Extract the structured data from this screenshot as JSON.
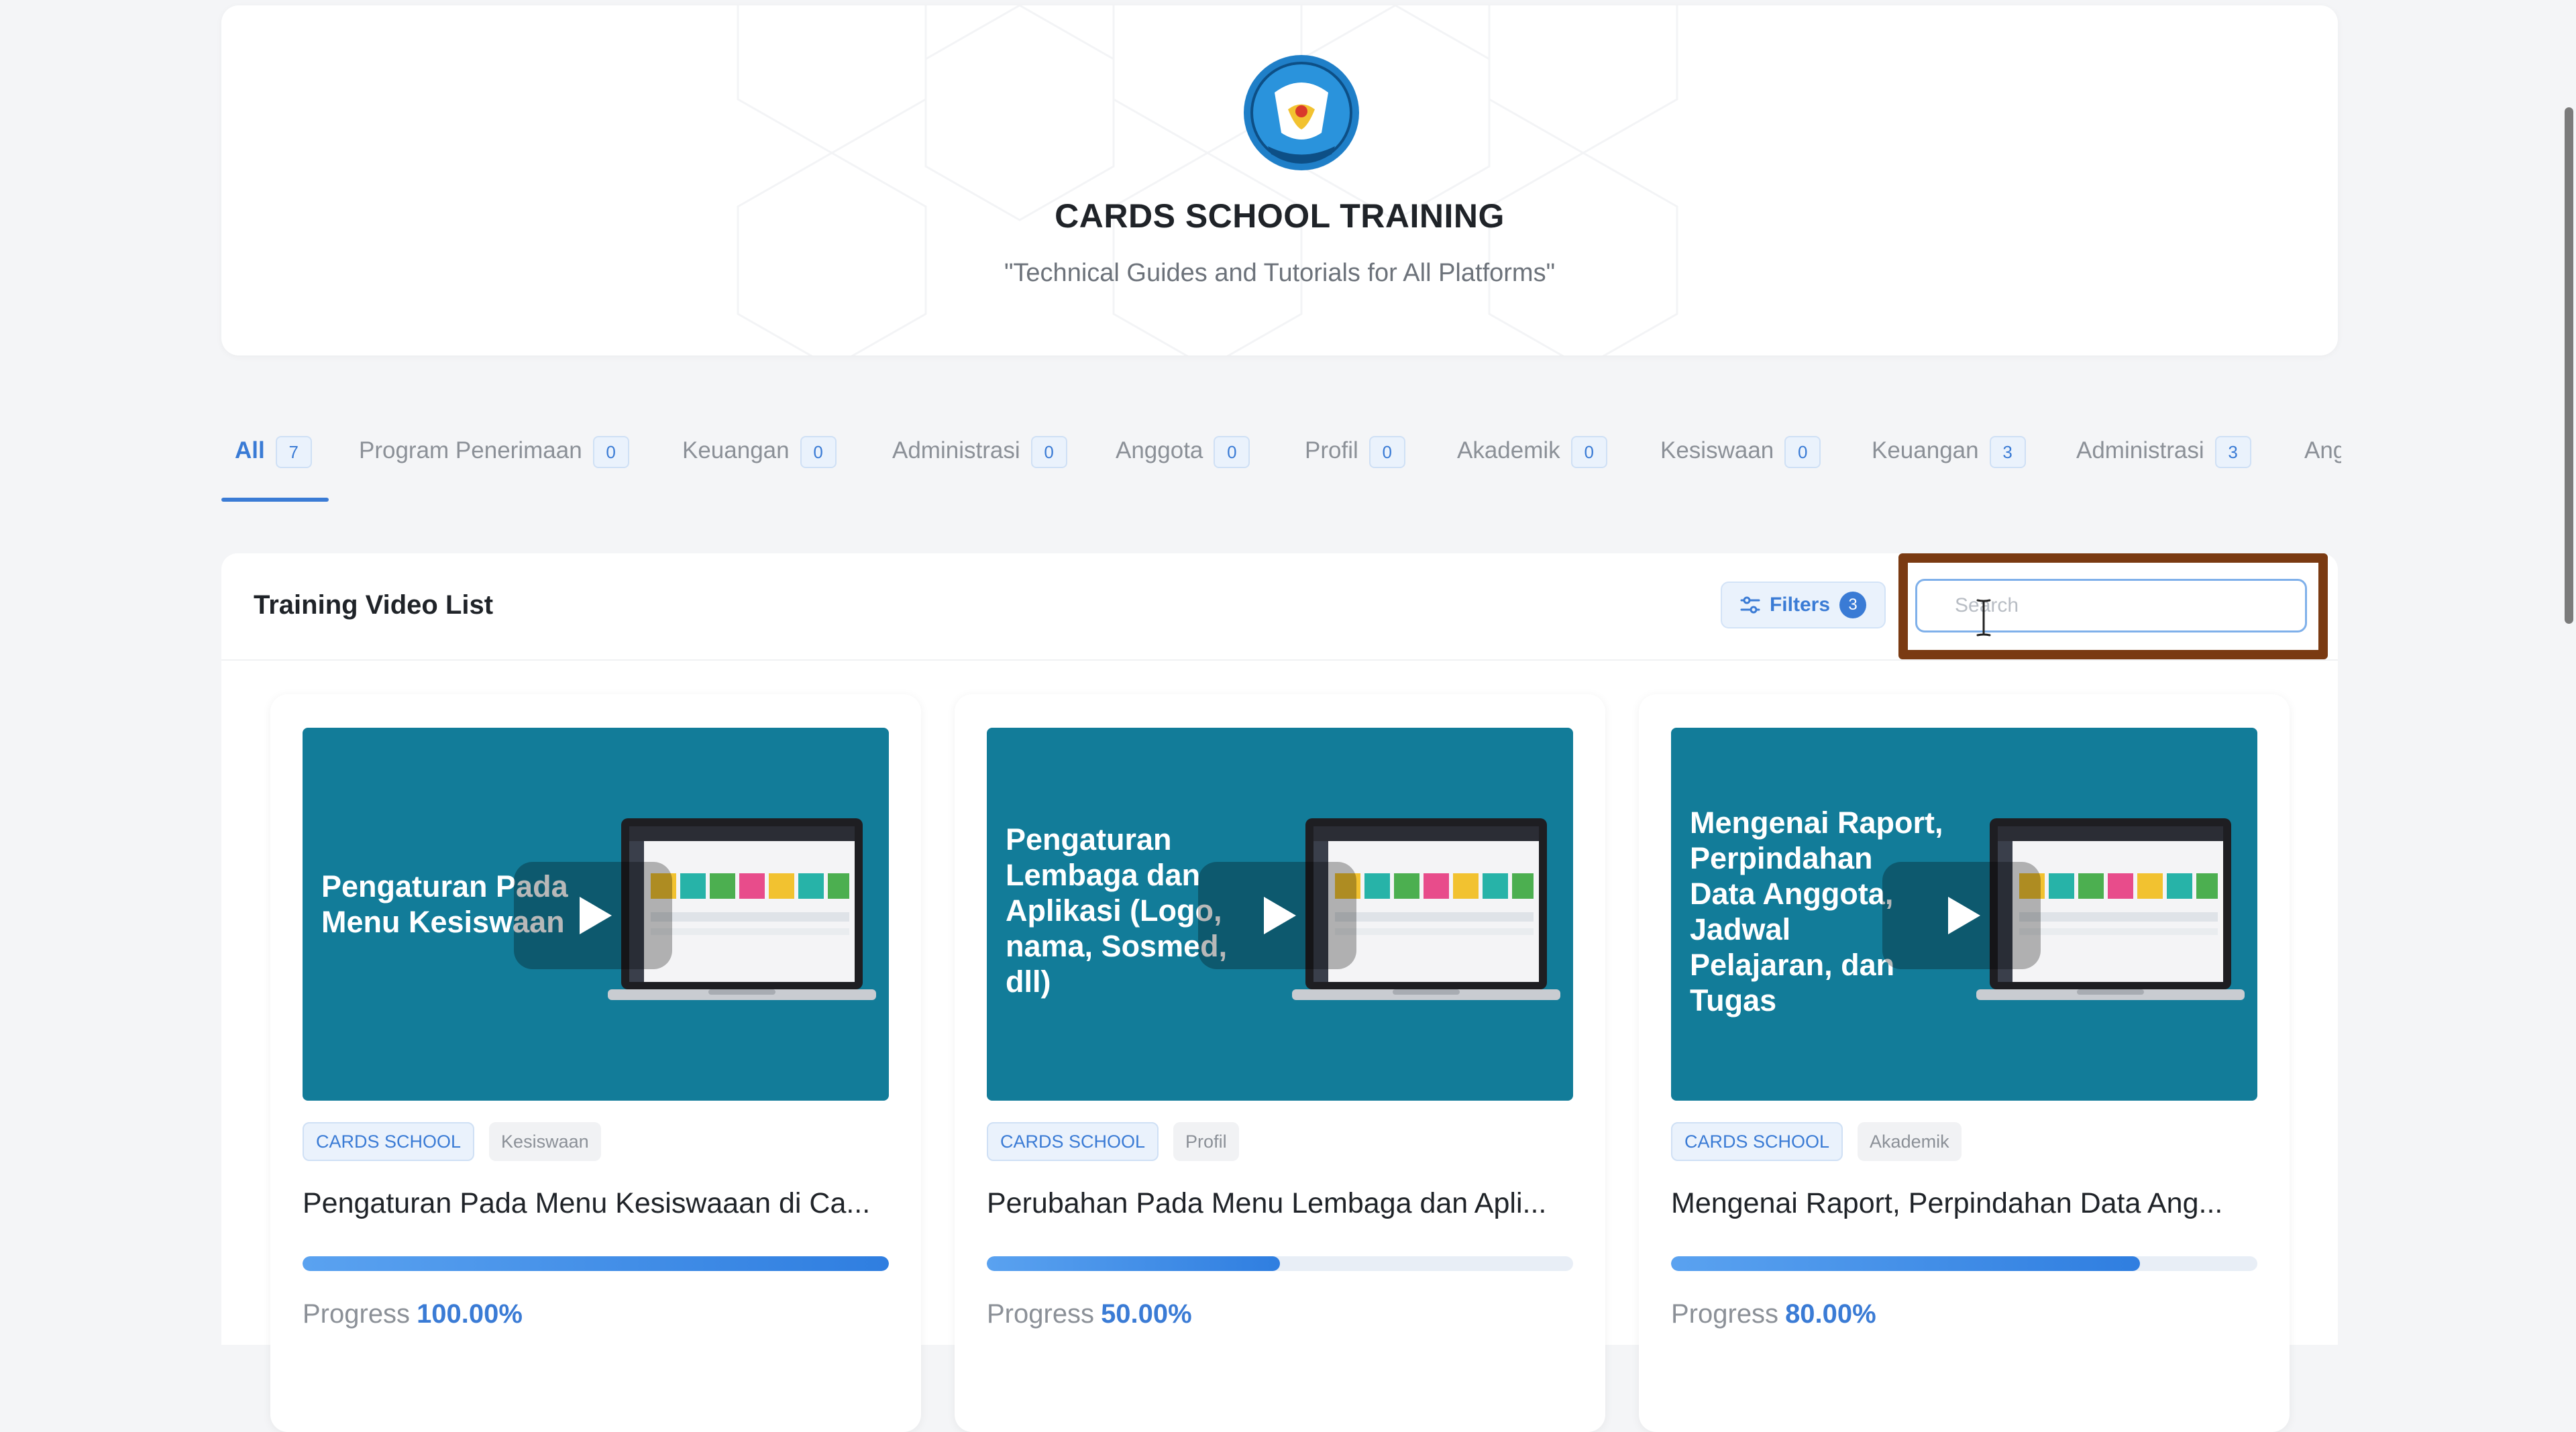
{
  "header": {
    "title": "CARDS SCHOOL TRAINING",
    "subtitle": "\"Technical Guides and Tutorials for All Platforms\""
  },
  "tabs": [
    {
      "label": "All",
      "count": "7",
      "active": true
    },
    {
      "label": "Program Penerimaan",
      "count": "0"
    },
    {
      "label": "Keuangan",
      "count": "0"
    },
    {
      "label": "Administrasi",
      "count": "0"
    },
    {
      "label": "Anggota",
      "count": "0"
    },
    {
      "label": "Profil",
      "count": "0"
    },
    {
      "label": "Akademik",
      "count": "0"
    },
    {
      "label": "Kesiswaan",
      "count": "0"
    },
    {
      "label": "Keuangan",
      "count": "3"
    },
    {
      "label": "Administrasi",
      "count": "3"
    },
    {
      "label": "Anggota",
      "count": ""
    }
  ],
  "panel": {
    "title": "Training Video List",
    "filters_label": "Filters",
    "filters_count": "3",
    "search_placeholder": "Search"
  },
  "cards": [
    {
      "thumb_text": "Pengaturan Pada\nMenu Kesiswaan",
      "tag_primary": "CARDS SCHOOL",
      "tag_secondary": "Kesiswaan",
      "title": "Pengaturan Pada Menu Kesiswaaan di Ca...",
      "progress_label": "Progress",
      "progress_value": "100.00%",
      "progress": 100
    },
    {
      "thumb_text": "Pengaturan\nLembaga dan\nAplikasi (Logo,\nnama, Sosmed,\ndll)",
      "tag_primary": "CARDS SCHOOL",
      "tag_secondary": "Profil",
      "title": "Perubahan Pada Menu Lembaga dan Apli...",
      "progress_label": "Progress",
      "progress_value": "50.00%",
      "progress": 50
    },
    {
      "thumb_text": "Mengenai Raport,\nPerpindahan\nData Anggota,\nJadwal\nPelajaran, dan\nTugas",
      "tag_primary": "CARDS SCHOOL",
      "tag_secondary": "Akademik",
      "title": "Mengenai Raport, Perpindahan Data Ang...",
      "progress_label": "Progress",
      "progress_value": "80.00%",
      "progress": 80
    }
  ],
  "colors": {
    "accent": "#3a7bd5",
    "thumbnail": "#127c99",
    "highlight_box": "#7a3a12"
  }
}
